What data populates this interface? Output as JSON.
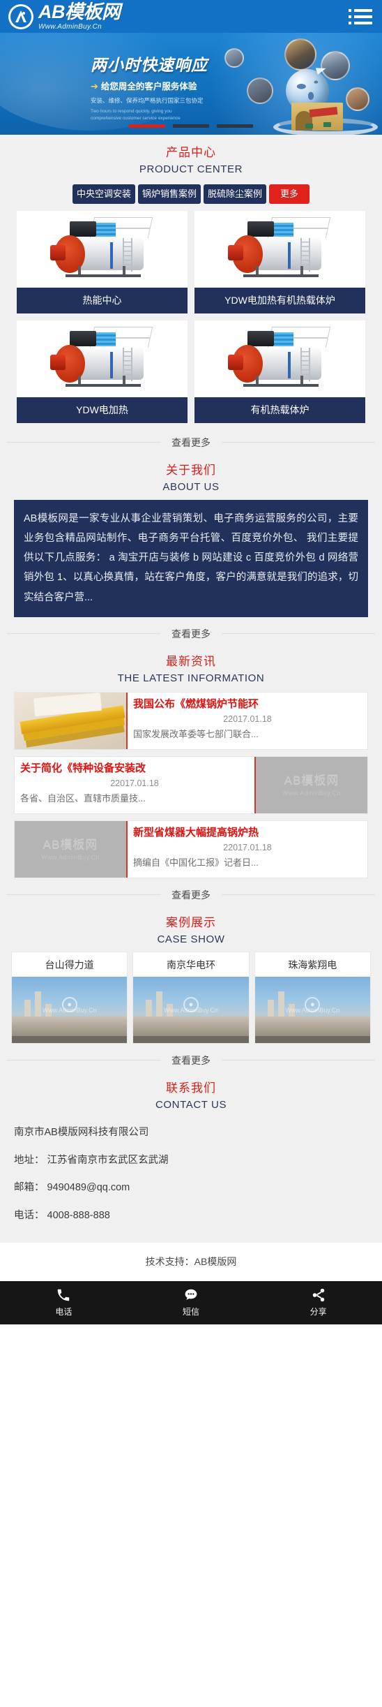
{
  "header": {
    "logo_title": "AB模板网",
    "logo_sub": "Www.AdminBuy.Cn",
    "menu_icon": "hamburger-menu-icon"
  },
  "banner": {
    "headline": "两小时快速响应",
    "subhead": "给您周全的客户服务体验",
    "tagline": "安装、维修、保养均严格执行国家三包协定",
    "english": "Two hours to respond quickly, giving you comprehensive customer service experience",
    "slides": 3,
    "active_slide": 1
  },
  "product_section": {
    "title_cn": "产品中心",
    "title_en": "PRODUCT CENTER",
    "tabs": [
      {
        "label": "中央空调安装",
        "active": true
      },
      {
        "label": "锅炉销售案例",
        "active": false
      },
      {
        "label": "脱硫除尘案例",
        "active": false
      },
      {
        "label": "更多",
        "active": false,
        "style": "red"
      }
    ],
    "products": [
      {
        "name": "热能中心"
      },
      {
        "name": "YDW电加热有机热载体炉"
      },
      {
        "name": "YDW电加热"
      },
      {
        "name": "有机热载体炉"
      }
    ],
    "more_label": "查看更多"
  },
  "about_section": {
    "title_cn": "关于我们",
    "title_en": "ABOUT US",
    "body": "AB模板网是一家专业从事企业营销策划、电子商务运营服务的公司，主要业务包含精品网站制作、电子商务平台托管、百度竞价外包、 我们主要提供以下几点服务： a 淘宝开店与装修 b 网站建设 c 百度竞价外包 d 网络营销外包 1、以真心换真情，站在客户角度，客户的满意就是我们的追求，切实结合客户营...",
    "more_label": "查看更多"
  },
  "news_section": {
    "title_cn": "最新资讯",
    "title_en": "THE LATEST INFORMATION",
    "items": [
      {
        "title": "我国公布《燃煤锅炉节能环",
        "date": "22017.01.18",
        "desc": "国家发展改革委等七部门联合...",
        "thumb": "ruler-photo",
        "layout": "image-left"
      },
      {
        "title": "关于简化《特种设备安装改",
        "date": "22017.01.18",
        "desc": "各省、自治区、直辖市质量技...",
        "thumb": "watermark-placeholder",
        "layout": "image-right"
      },
      {
        "title": "新型省煤器大幅提高锅炉热",
        "date": "22017.01.18",
        "desc": "摘编自《中国化工报》记者日...",
        "thumb": "watermark-placeholder",
        "layout": "image-left"
      }
    ],
    "thumb_watermark_main": "AB模板网",
    "thumb_watermark_sub": "Www.AdminBuy.Cn",
    "more_label": "查看更多"
  },
  "case_section": {
    "title_cn": "案例展示",
    "title_en": "CASE SHOW",
    "cases": [
      {
        "name": "台山得力道",
        "watermark": "Www.AdminBuy.Cn"
      },
      {
        "name": "南京华电环",
        "watermark": "Www.AdminBuy.Cn"
      },
      {
        "name": "珠海紫翔电",
        "watermark": "Www.AdminBuy.Cn"
      }
    ],
    "more_label": "查看更多"
  },
  "contact_section": {
    "title_cn": "联系我们",
    "title_en": "CONTACT US",
    "company": "南京市AB模版网科技有限公司",
    "address": "地址： 江苏省南京市玄武区玄武湖",
    "email": "邮箱： 9490489@qq.com",
    "phone": "电话： 4008-888-888"
  },
  "footer": {
    "support": "技术支持：AB模版网"
  },
  "bottom_bar": {
    "items": [
      {
        "label": "电话",
        "icon": "phone-icon"
      },
      {
        "label": "短信",
        "icon": "message-icon"
      },
      {
        "label": "分享",
        "icon": "share-icon"
      }
    ]
  },
  "colors": {
    "header_blue": "#1271c4",
    "accent_red": "#d9201c",
    "navy": "#22305c",
    "page_bg": "#f0f0f0"
  }
}
